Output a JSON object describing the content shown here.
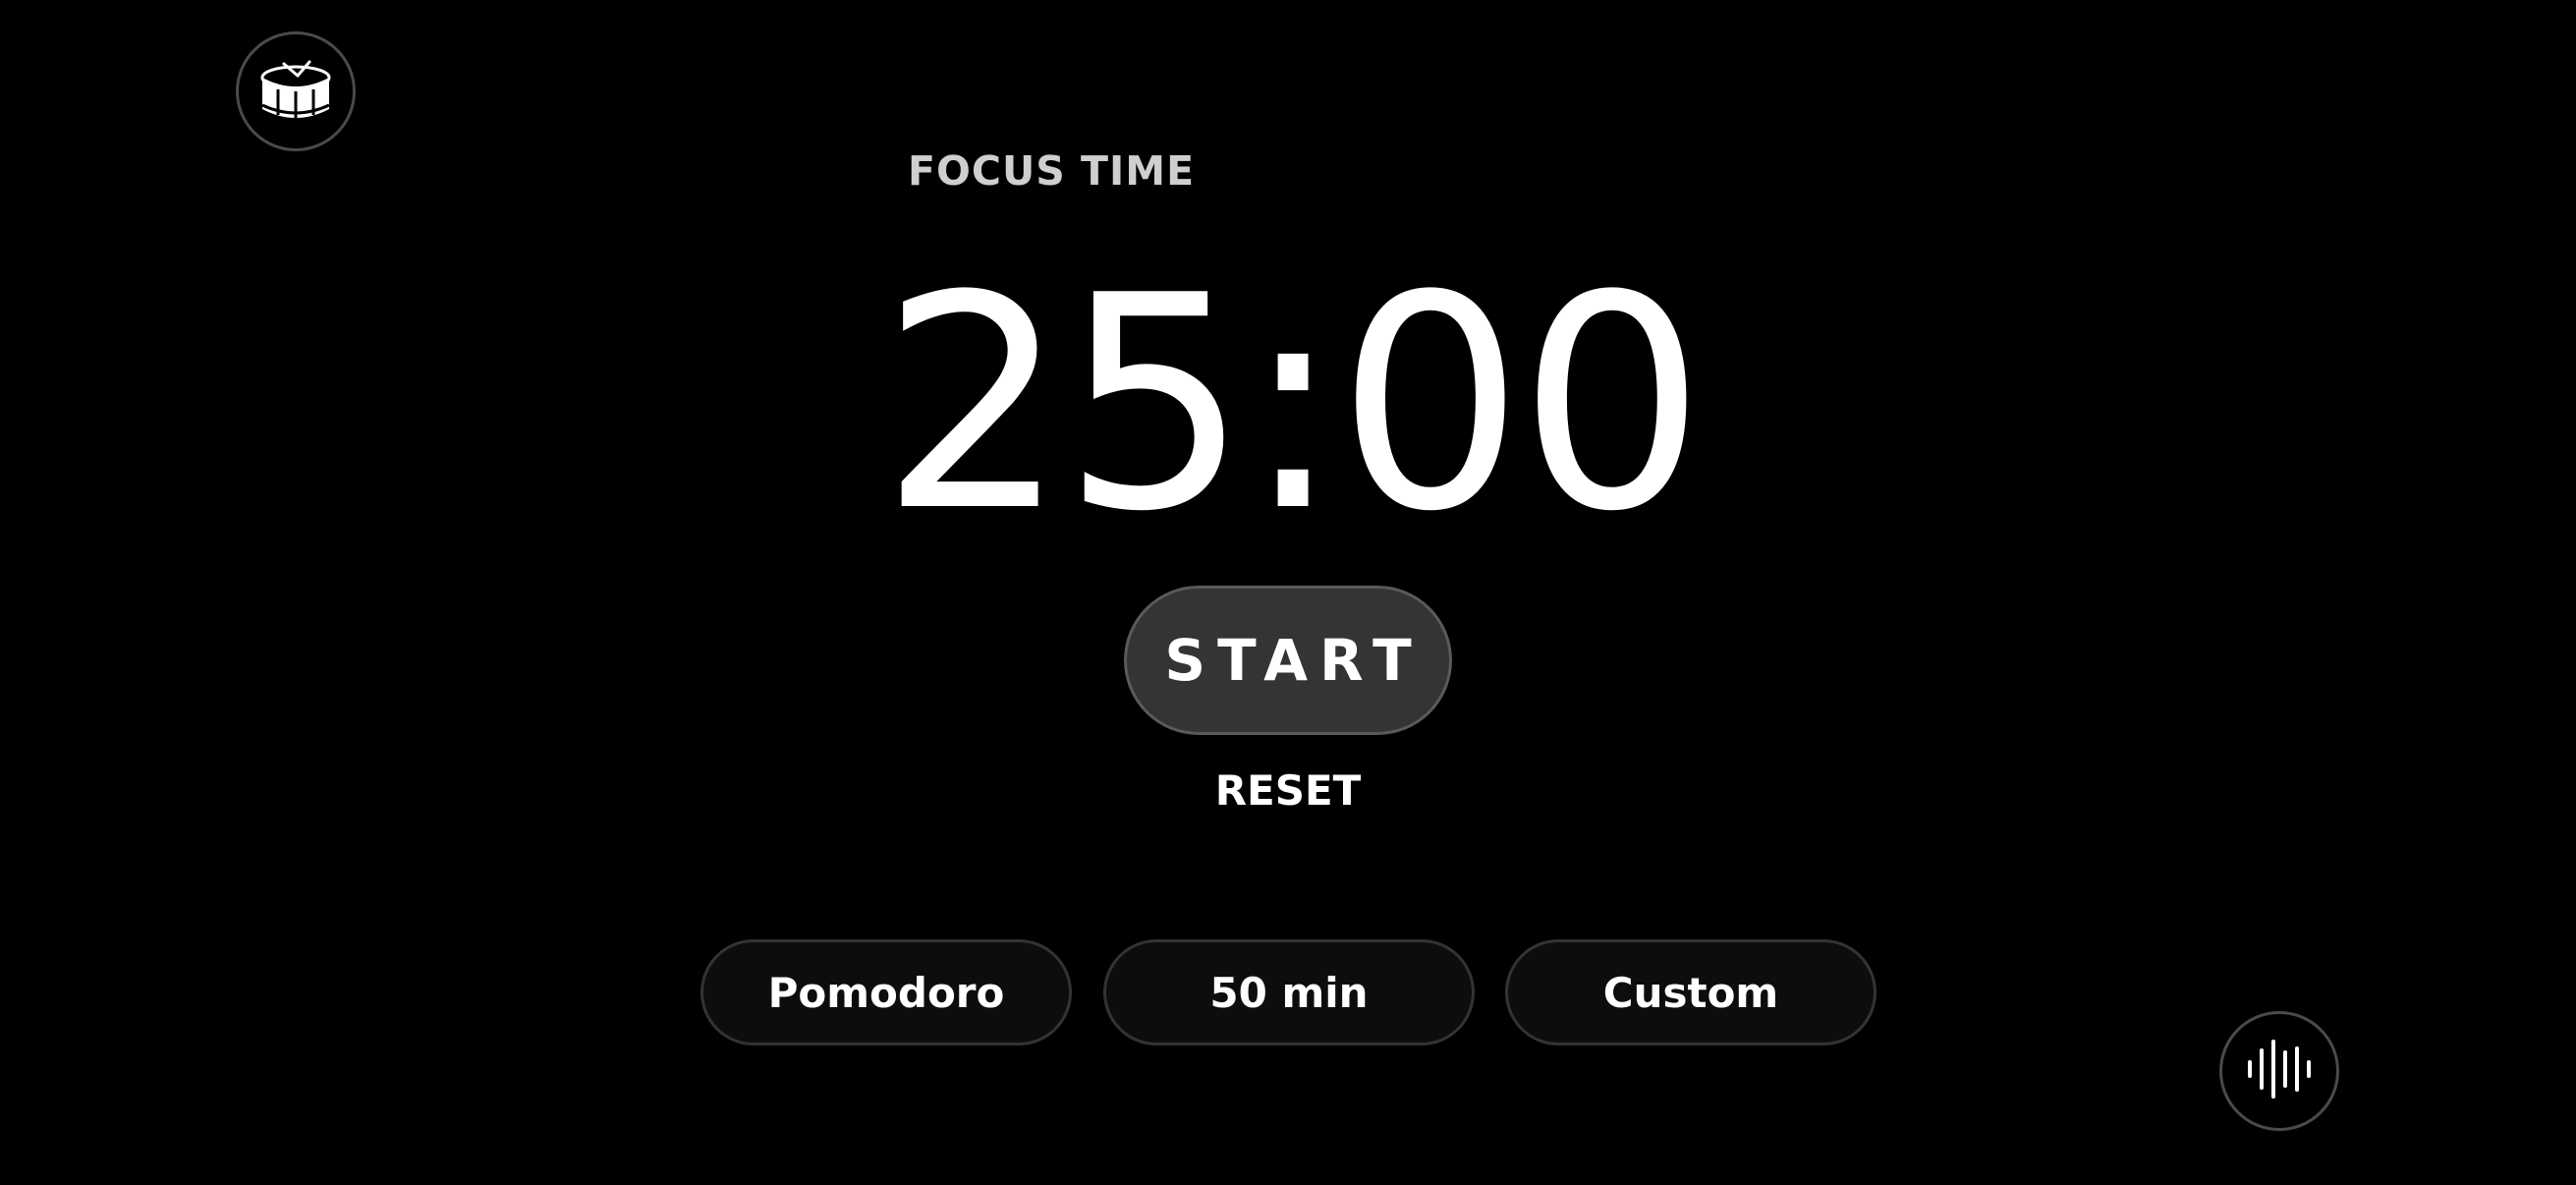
{
  "header": {
    "drum_icon": "drum-clock-icon"
  },
  "timer": {
    "mode_label": "FOCUS TIME",
    "display": "25:00"
  },
  "controls": {
    "start_label": "START",
    "reset_label": "RESET"
  },
  "presets": [
    {
      "label": "Pomodoro"
    },
    {
      "label": "50 min"
    },
    {
      "label": "Custom"
    }
  ],
  "footer": {
    "sound_icon": "sound-wave-icon"
  },
  "colors": {
    "background": "#000000",
    "text": "#ffffff",
    "muted_text": "#cfcfcf",
    "start_button_bg": "#343434",
    "preset_bg": "#0d0d0d",
    "border": "#4a4a4a"
  }
}
